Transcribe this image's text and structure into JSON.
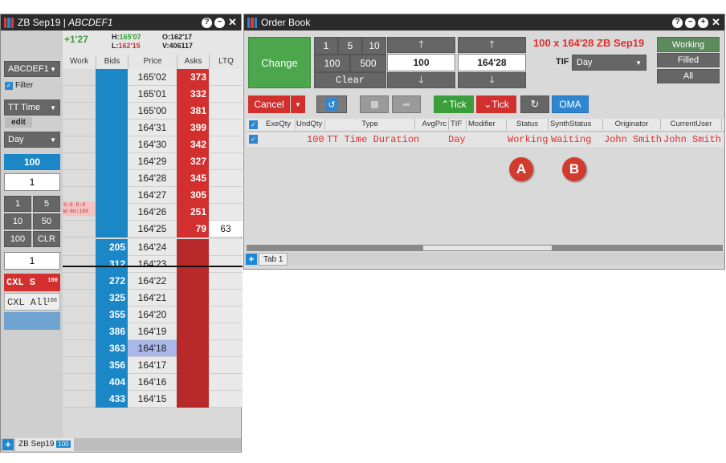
{
  "ladder": {
    "title_contract": "ZB Sep19",
    "title_account": "ABCDEF1",
    "net_change": "+1'27",
    "high_label": "H:",
    "high": "165'07",
    "low_label": "L:",
    "low": "162'15",
    "open_label": "O:",
    "open": "162'17",
    "volume_label": "V:",
    "volume": "406117",
    "account_select": "ABCDEF1",
    "filter_label": "Filter",
    "order_type": "TT Time",
    "edit_label": "edit",
    "tif": "Day",
    "qty_highlight": "100",
    "qty_value": "1",
    "qty_buttons": [
      "1",
      "5",
      "10",
      "50",
      "100",
      "CLR"
    ],
    "order_qty": "1",
    "cxl_s": "CXL S",
    "cxl_s_qty": "100",
    "cxl_all": "CXL All",
    "cxl_all_qty": "100",
    "columns": [
      "Work",
      "Bids",
      "Price",
      "Asks",
      "LTQ"
    ],
    "working_note_1": "S:0  D:0",
    "working_note_2": "W:0U:100",
    "rows": [
      {
        "price": "165'02",
        "bid": "",
        "ask": "373",
        "ltq": ""
      },
      {
        "price": "165'01",
        "bid": "",
        "ask": "332",
        "ltq": ""
      },
      {
        "price": "165'00",
        "bid": "",
        "ask": "381",
        "ltq": ""
      },
      {
        "price": "164'31",
        "bid": "",
        "ask": "399",
        "ltq": ""
      },
      {
        "price": "164'30",
        "bid": "",
        "ask": "342",
        "ltq": ""
      },
      {
        "price": "164'29",
        "bid": "",
        "ask": "327",
        "ltq": ""
      },
      {
        "price": "164'28",
        "bid": "",
        "ask": "345",
        "ltq": ""
      },
      {
        "price": "164'27",
        "bid": "",
        "ask": "305",
        "ltq": ""
      },
      {
        "price": "164'26",
        "bid": "",
        "ask": "251",
        "ltq": ""
      },
      {
        "price": "164'25",
        "bid": "",
        "ask": "79",
        "ltq": "63"
      },
      {
        "price": "164'24",
        "bid": "205",
        "ask": "",
        "ltq": ""
      },
      {
        "price": "164'23",
        "bid": "312",
        "ask": "",
        "ltq": ""
      },
      {
        "price": "164'22",
        "bid": "272",
        "ask": "",
        "ltq": ""
      },
      {
        "price": "164'21",
        "bid": "325",
        "ask": "",
        "ltq": ""
      },
      {
        "price": "164'20",
        "bid": "355",
        "ask": "",
        "ltq": ""
      },
      {
        "price": "164'19",
        "bid": "386",
        "ask": "",
        "ltq": ""
      },
      {
        "price": "164'18",
        "bid": "363",
        "ask": "",
        "ltq": ""
      },
      {
        "price": "164'17",
        "bid": "356",
        "ask": "",
        "ltq": ""
      },
      {
        "price": "164'16",
        "bid": "404",
        "ask": "",
        "ltq": ""
      },
      {
        "price": "164'15",
        "bid": "433",
        "ask": "",
        "ltq": ""
      }
    ],
    "bottom_tab": "ZB Sep19",
    "bottom_tab_qty": "100"
  },
  "order_book": {
    "title": "Order Book",
    "change_label": "Change",
    "qty_buttons": [
      "1",
      "5",
      "10",
      "100",
      "500"
    ],
    "clear_label": "Clear",
    "qty_value": "100",
    "price_value": "164'28",
    "order_summary": "100 x 164'28 ZB Sep19",
    "tif_label": "TIF",
    "tif_value": "Day",
    "filters": [
      "Working",
      "Filled",
      "All"
    ],
    "cancel_label": "Cancel",
    "up_tick_label": "Tick",
    "down_tick_label": "Tick",
    "oma_label": "OMA",
    "columns": [
      "ExeQty",
      "UndQty",
      "Type",
      "AvgPrc",
      "TIF",
      "Modifier",
      "Status",
      "SynthStatus",
      "Originator",
      "CurrentUser"
    ],
    "order_row": {
      "undqty": "100",
      "type": "TT Time Duration",
      "tif": "Day",
      "status": "Working",
      "synth_status": "Waiting",
      "originator": "John Smith",
      "current_user": "John Smith"
    },
    "callout_a": "A",
    "callout_b": "B",
    "tab_label": "Tab 1"
  },
  "colors": {
    "bid": "#1b87c6",
    "ask": "#d22f2f",
    "green": "#3a9f3a",
    "red_text": "#e03030"
  }
}
